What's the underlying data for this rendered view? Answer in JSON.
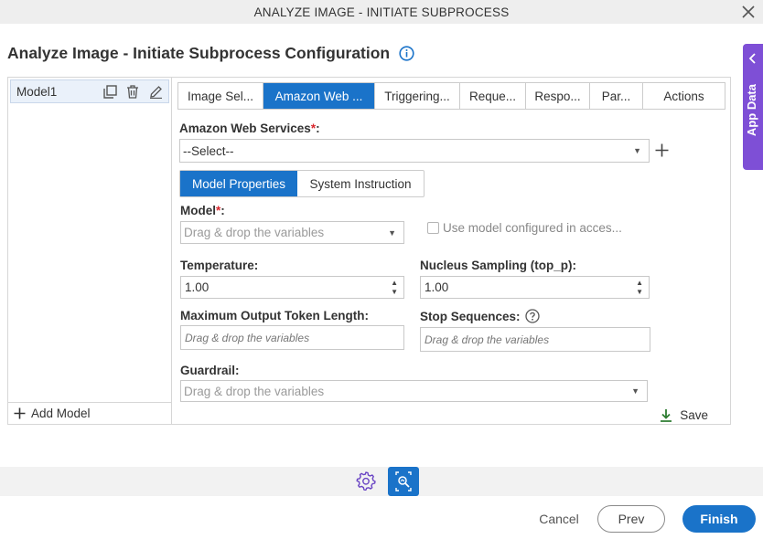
{
  "window": {
    "title": "ANALYZE IMAGE - INITIATE SUBPROCESS"
  },
  "page": {
    "title": "Analyze Image - Initiate Subprocess Configuration"
  },
  "app_data": {
    "label": "App Data"
  },
  "models": {
    "items": [
      {
        "name": "Model1"
      }
    ],
    "add_label": "Add Model"
  },
  "tabs": [
    {
      "label": "Image Sel..."
    },
    {
      "label": "Amazon Web ..."
    },
    {
      "label": "Triggering..."
    },
    {
      "label": "Reque..."
    },
    {
      "label": "Respo..."
    },
    {
      "label": "Par..."
    },
    {
      "label": "Actions"
    }
  ],
  "active_tab": "Amazon Web ...",
  "aws": {
    "label": "Amazon Web Services",
    "required": "*",
    "suffix": ":",
    "value": "--Select--"
  },
  "subtabs": [
    {
      "label": "Model Properties"
    },
    {
      "label": "System Instruction"
    }
  ],
  "model": {
    "label": "Model",
    "required": "*",
    "suffix": ":",
    "placeholder": "Drag & drop the variables",
    "checkbox_label": "Use model configured in acces..."
  },
  "temperature": {
    "label": "Temperature:",
    "value": "1.00"
  },
  "top_p": {
    "label": "Nucleus Sampling (top_p):",
    "value": "1.00"
  },
  "max_tokens": {
    "label": "Maximum Output Token Length:",
    "placeholder": "Drag & drop the variables"
  },
  "stop_sequences": {
    "label": "Stop Sequences:",
    "placeholder": "Drag & drop the variables"
  },
  "guardrail": {
    "label": "Guardrail:",
    "placeholder": "Drag & drop the variables"
  },
  "save_label": "Save",
  "footer": {
    "cancel": "Cancel",
    "prev": "Prev",
    "finish": "Finish"
  },
  "colors": {
    "primary": "#1a73c9",
    "app_data": "#7e4fd6",
    "required": "#d9262c",
    "save_icon": "#2e7d32"
  }
}
